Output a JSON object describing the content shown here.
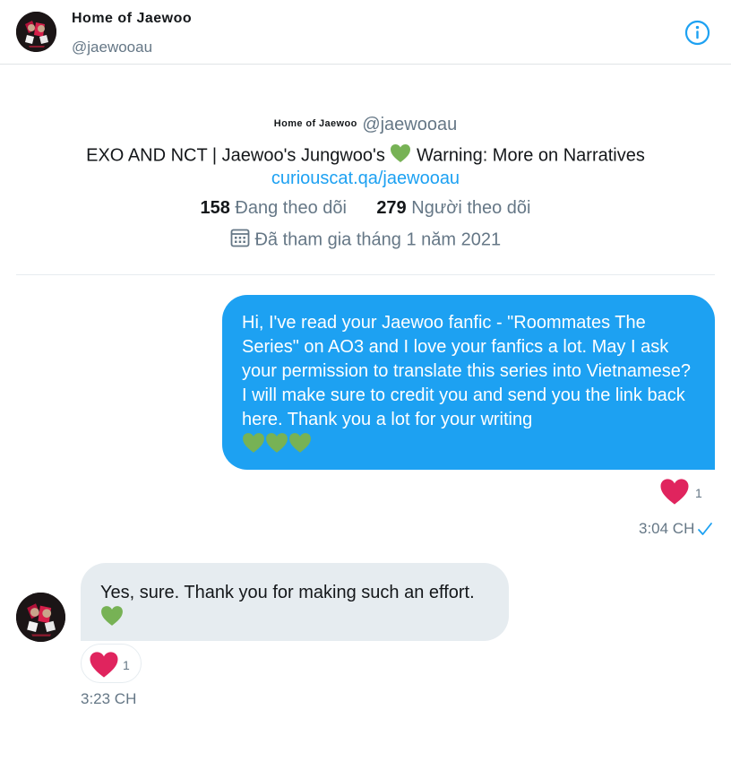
{
  "header": {
    "display_name": "Home of Jaewoo",
    "handle": "@jaewooau",
    "info_icon": "info-icon"
  },
  "profile": {
    "display_name": "Home of Jaewoo",
    "handle": "@jaewooau",
    "bio_before_emoji": "EXO AND NCT | Jaewoo's Jungwoo's ",
    "bio_emoji": "green-heart-emoji",
    "bio_after_emoji": " Warning: More on Narratives",
    "link": "curiouscat.qa/jaewooau",
    "following_count": "158",
    "following_label": "Đang theo dõi",
    "followers_count": "279",
    "followers_label": "Người theo dõi",
    "joined_icon": "calendar-icon",
    "joined": "Đã tham gia tháng 1 năm 2021"
  },
  "messages": [
    {
      "direction": "sent",
      "text": "Hi, I've read your Jaewoo fanfic - \"Roommates The Series\" on AO3 and I love your fanfics a lot. May I ask your permission to translate this series into Vietnamese? I will make sure to credit you and send you the link back here. Thank you a lot for your writing",
      "emoji": [
        "green-heart-emoji",
        "green-heart-emoji",
        "green-heart-emoji"
      ],
      "reaction_icon": "red-heart-icon",
      "reaction_count": "1",
      "time": "3:04 CH",
      "status_icon": "checkmark-icon"
    },
    {
      "direction": "received",
      "text": "Yes, sure. Thank you for making such an effort.",
      "emoji": [
        "green-heart-emoji"
      ],
      "reaction_icon": "red-heart-icon",
      "reaction_count": "1",
      "time": "3:23 CH"
    }
  ],
  "colors": {
    "accent": "#1da1f2",
    "received_bubble": "#e6ecf0",
    "secondary_text": "#657786",
    "heart_red": "#e0245e",
    "green_heart": "#77b255"
  }
}
